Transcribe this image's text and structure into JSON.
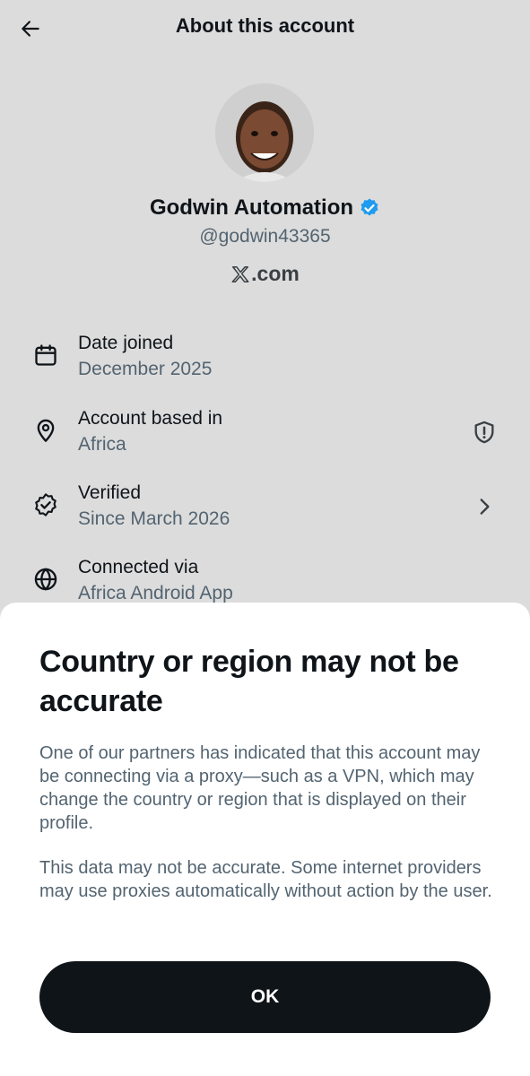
{
  "header": {
    "title": "About this account",
    "back_icon": "arrow-left-icon"
  },
  "profile": {
    "display_name": "Godwin Automation",
    "handle": "@godwin43365",
    "verified_badge_color": "#1d9bf0",
    "platform_label": ".com",
    "platform_logo": "x-logo-icon"
  },
  "rows": [
    {
      "icon": "calendar-icon",
      "title": "Date joined",
      "subtitle": "December 2025"
    },
    {
      "icon": "location-pin-icon",
      "title": "Account based in",
      "subtitle": "Africa",
      "trail_icon": "shield-alert-icon"
    },
    {
      "icon": "verified-badge-outline-icon",
      "title": "Verified",
      "subtitle": "Since March 2026",
      "trail_icon": "chevron-right-icon"
    },
    {
      "icon": "globe-icon",
      "title": "Connected via",
      "subtitle": "Africa Android App"
    }
  ],
  "sheet": {
    "title": "Country or region may not be accurate",
    "paragraph1": "One of our partners has indicated that this account may be connecting via a proxy—such as a VPN, which may change the country or region that is displayed on their profile.",
    "paragraph2": "This data may not be accurate. Some internet providers may use proxies automatically without action by the user.",
    "button_label": "OK"
  },
  "colors": {
    "primary_text": "#0f1419",
    "secondary_text": "#536471",
    "button_bg": "#0f1419",
    "sheet_bg": "#ffffff",
    "backdrop": "#dcdcdc"
  }
}
